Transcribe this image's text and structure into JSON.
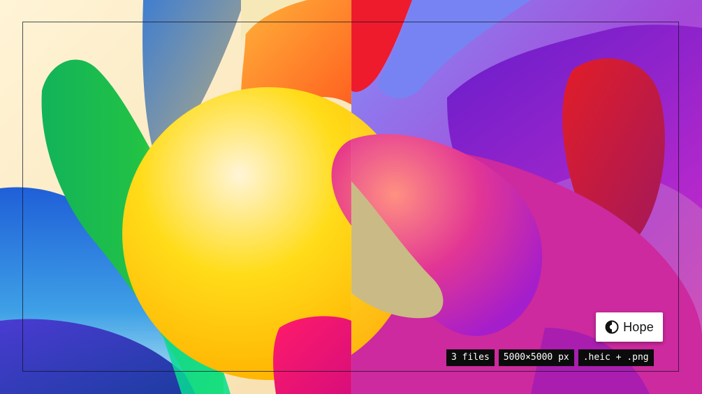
{
  "badge": {
    "icon": "contrast-icon",
    "label": "Hope"
  },
  "tags": [
    {
      "label": "3 files"
    },
    {
      "label": "5000×5000 px"
    },
    {
      "label": ".heic + .png"
    }
  ],
  "colors": {
    "cream": "#fbe8c0",
    "green": "#1fb553",
    "yellow": "#ffd200",
    "orange": "#ff7a1a",
    "red": "#e8102a",
    "purple": "#8a16c9",
    "magenta": "#d0158e",
    "blue": "#2f5bd6",
    "periwinkle": "#6f7cf2"
  }
}
